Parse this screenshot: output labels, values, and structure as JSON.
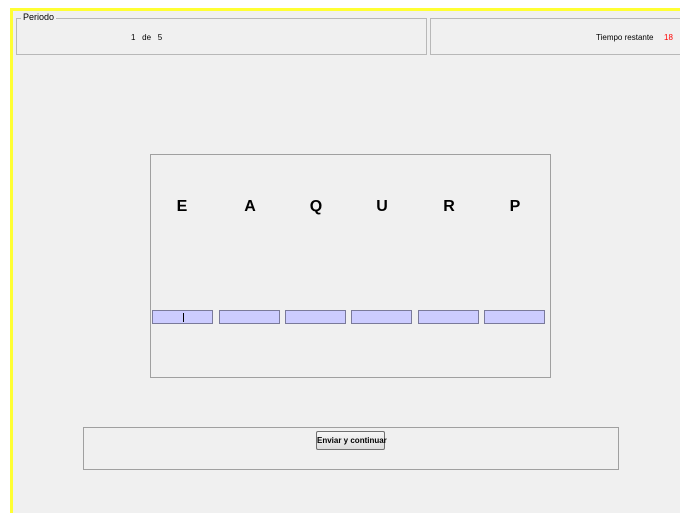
{
  "period": {
    "legend": "Periodo",
    "current": "1",
    "separator": "de",
    "total": "5"
  },
  "timer": {
    "label": "Tiempo restante",
    "value": "18",
    "value_color": "#ff0000"
  },
  "task": {
    "letters": [
      "E",
      "A",
      "Q",
      "U",
      "R",
      "P"
    ],
    "inputs": [
      {
        "value": ""
      },
      {
        "value": ""
      },
      {
        "value": ""
      },
      {
        "value": ""
      },
      {
        "value": ""
      },
      {
        "value": ""
      }
    ],
    "input_color": "#ccccff"
  },
  "submit": {
    "label": "Enviar y continuar"
  },
  "colors": {
    "frame_border": "#ffff33",
    "background": "#f0f0f0"
  }
}
